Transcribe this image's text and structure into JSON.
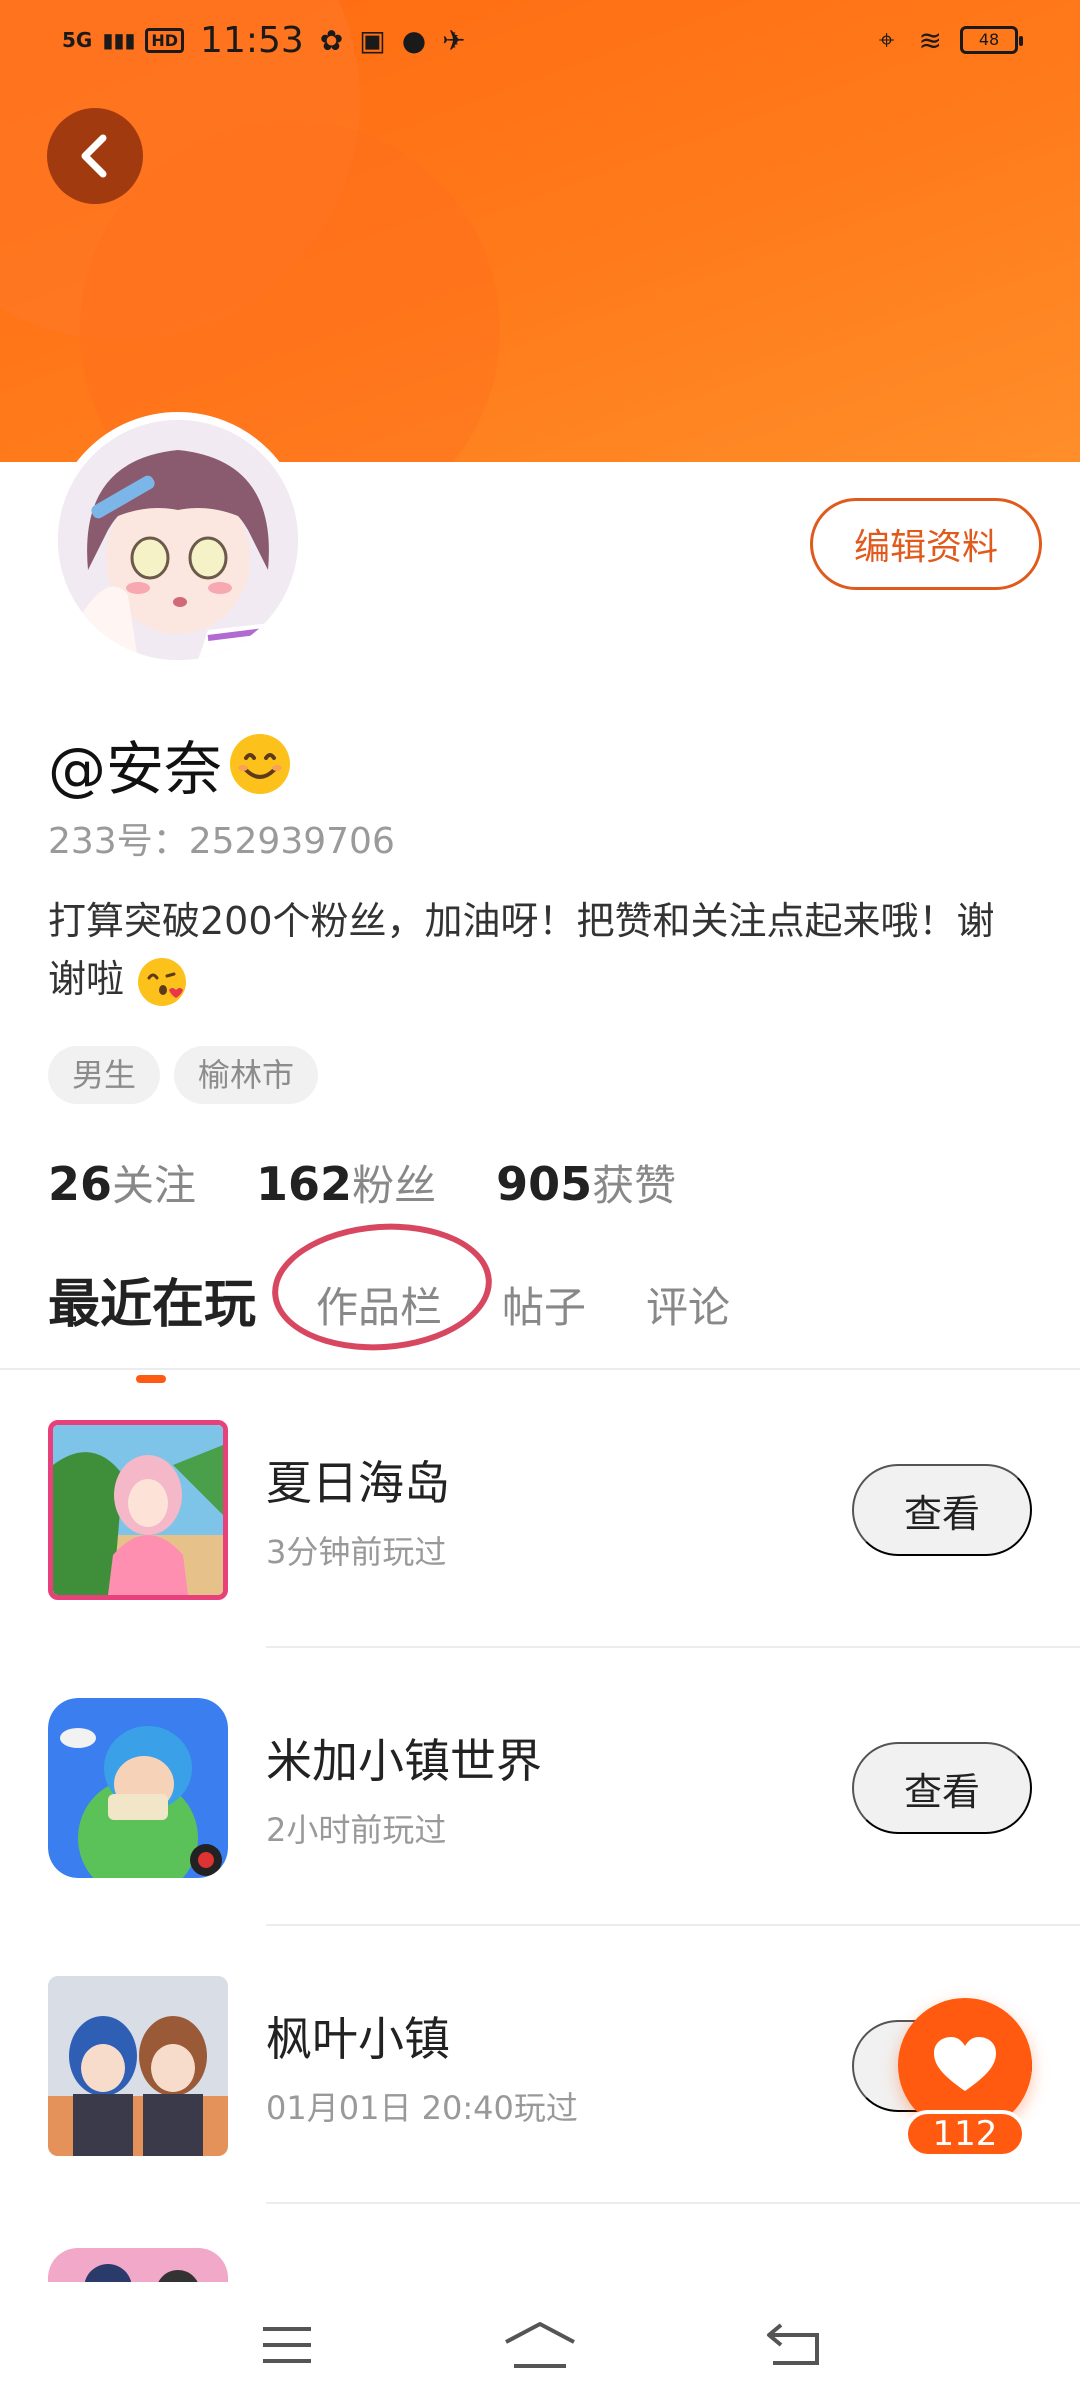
{
  "status_bar": {
    "network": "5G",
    "hd": "HD",
    "time": "11:53",
    "battery": "48"
  },
  "profile": {
    "username": "@安奈",
    "id_label": "233号：252939706",
    "bio": "打算突破200个粉丝，加油呀！把赞和关注点起来哦！谢谢啦",
    "tags": [
      "男生",
      "榆林市"
    ],
    "edit_button": "编辑资料"
  },
  "stats": [
    {
      "num": "26",
      "label": "关注"
    },
    {
      "num": "162",
      "label": "粉丝"
    },
    {
      "num": "905",
      "label": "获赞"
    }
  ],
  "tabs": [
    "最近在玩",
    "作品栏",
    "帖子",
    "评论"
  ],
  "games": [
    {
      "title": "夏日海岛",
      "time": "3分钟前玩过",
      "button": "查看"
    },
    {
      "title": "米加小镇世界",
      "time": "2小时前玩过",
      "button": "查看"
    },
    {
      "title": "枫叶小镇",
      "time": "01月01日 20:40玩过",
      "button": "查看"
    }
  ],
  "like": {
    "count": "112"
  },
  "colors": {
    "accent": "#ff5a0f",
    "header": "#ff7a1a",
    "annotation": "#d74760"
  }
}
